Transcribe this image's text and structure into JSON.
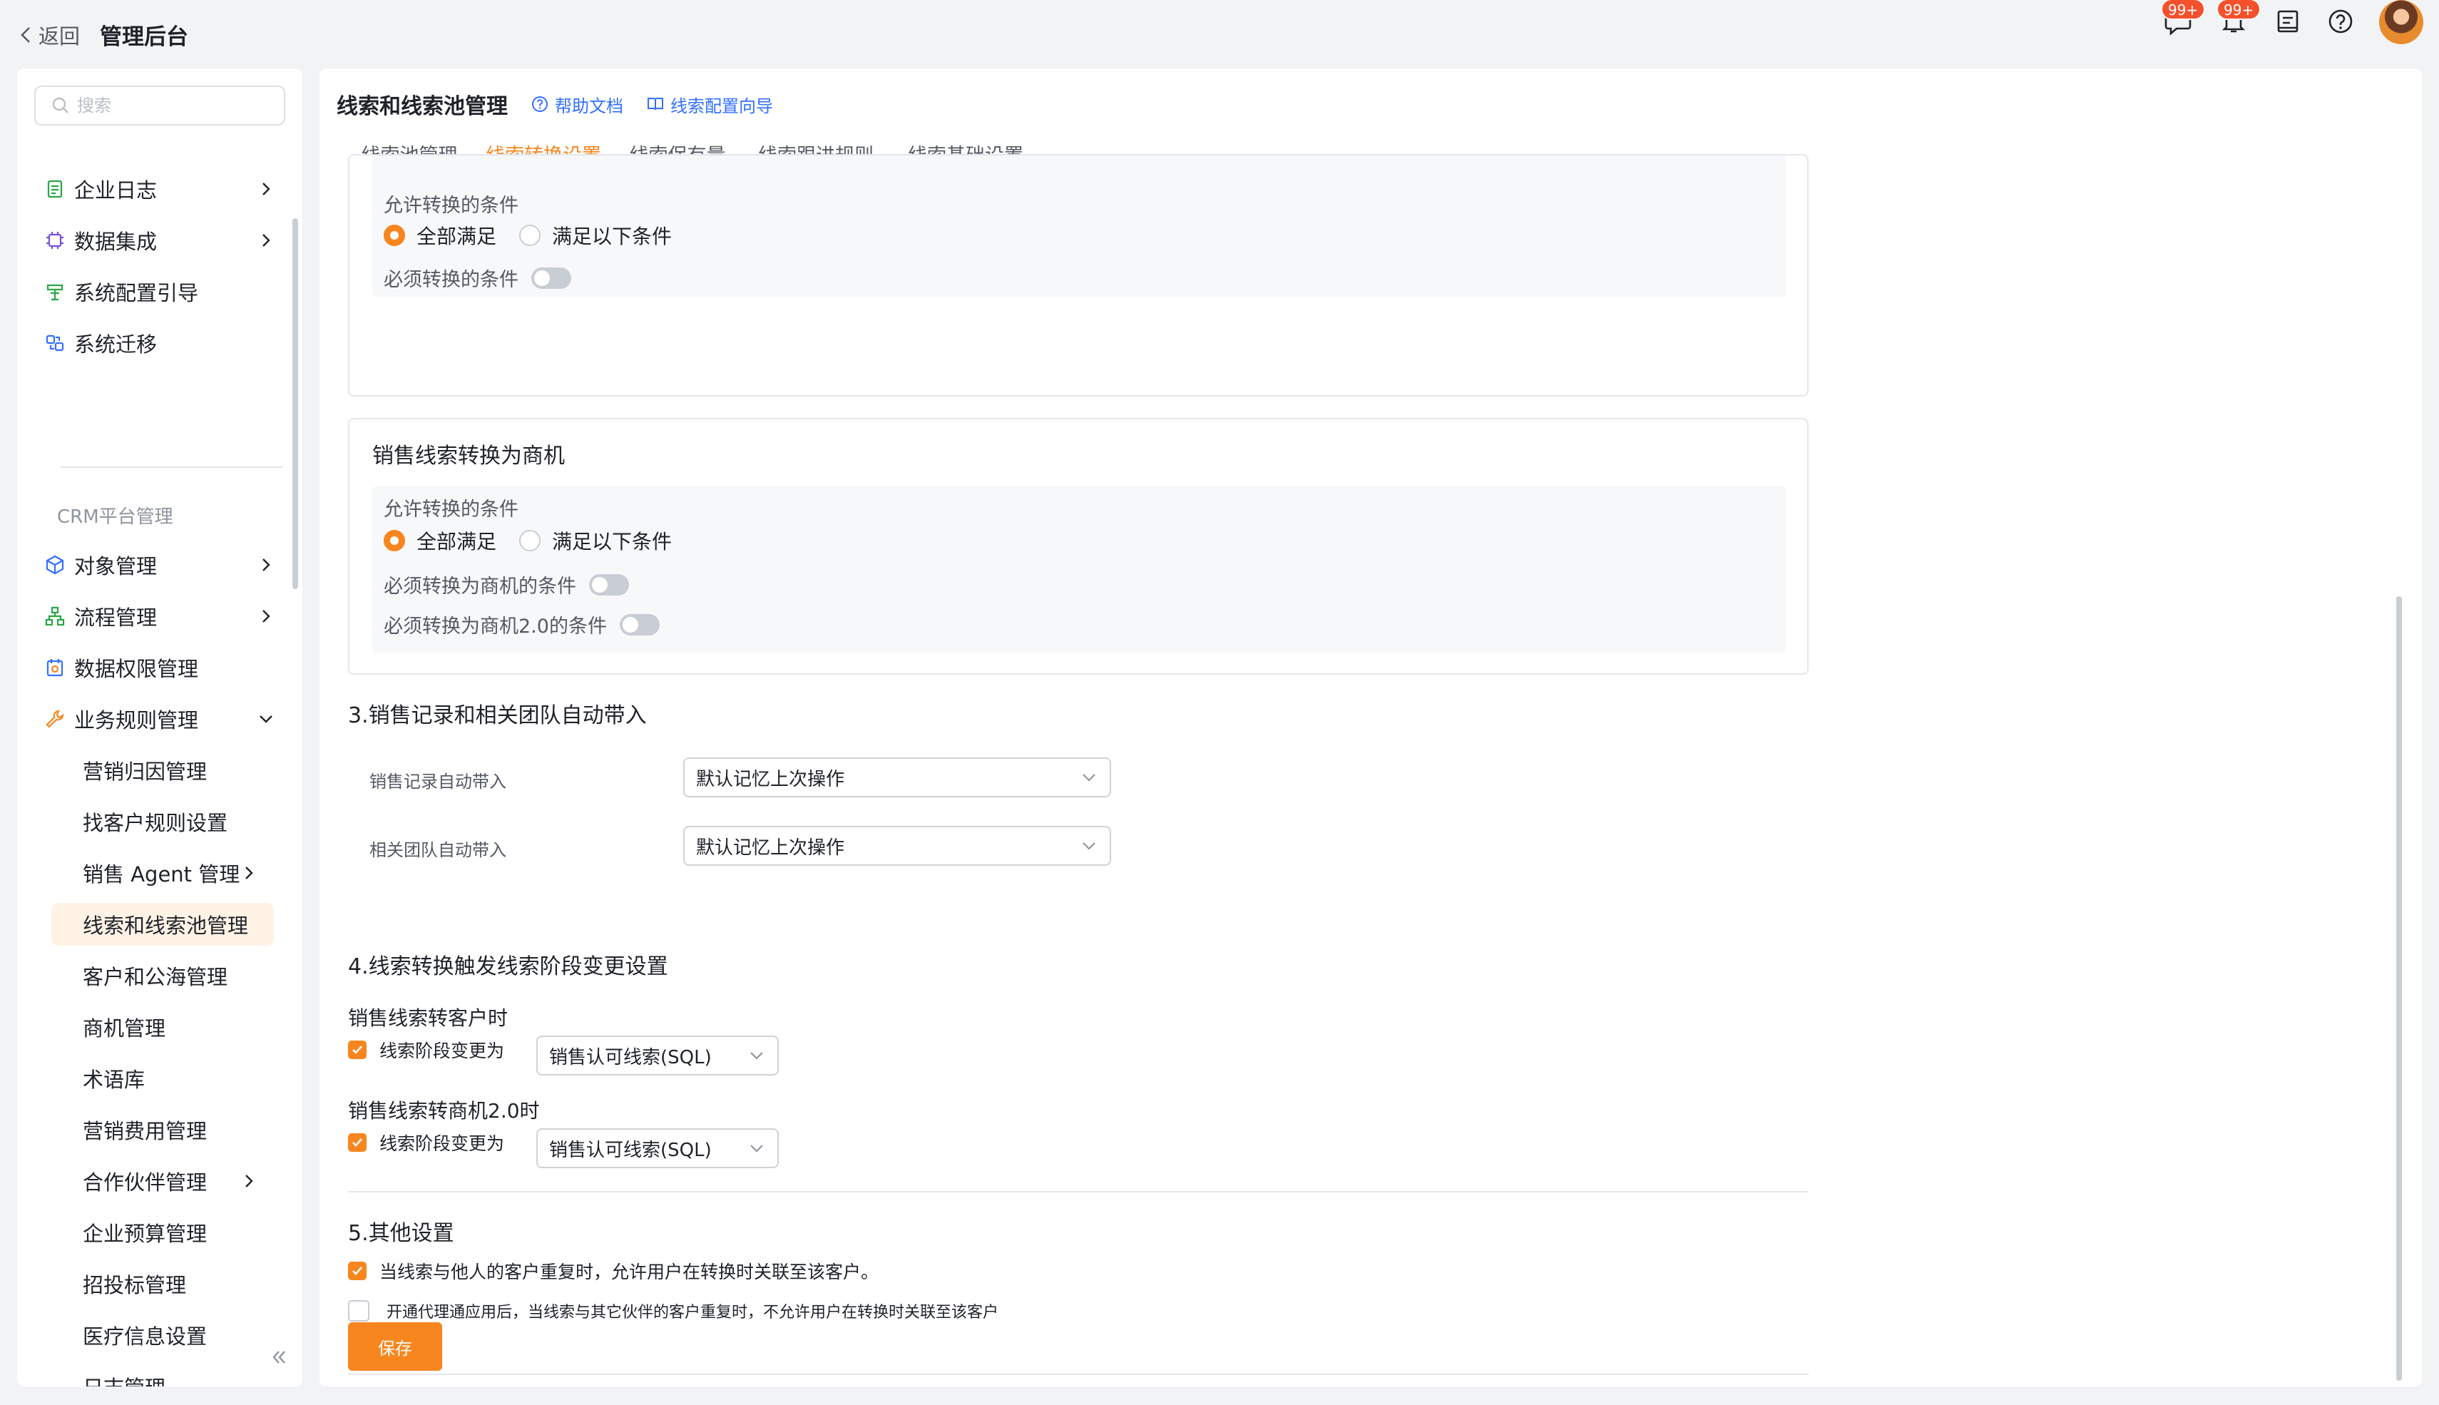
{
  "topbar": {
    "back_label": "返回",
    "app_title": "管理后台",
    "chat_badge": "99+",
    "bell_badge": "99+"
  },
  "sidebar": {
    "search_placeholder": "搜索",
    "top_items": [
      {
        "label": "企业日志",
        "icon": "log-icon"
      },
      {
        "label": "数据集成",
        "icon": "chip-icon"
      },
      {
        "label": "系统配置引导",
        "icon": "guide-icon"
      },
      {
        "label": "系统迁移",
        "icon": "migrate-icon"
      }
    ],
    "section_label": "CRM平台管理",
    "crm_items": [
      {
        "label": "对象管理",
        "icon": "cube-icon"
      },
      {
        "label": "流程管理",
        "icon": "flow-icon"
      },
      {
        "label": "数据权限管理",
        "icon": "permission-icon"
      },
      {
        "label": "业务规则管理",
        "icon": "wrench-icon"
      }
    ],
    "sub_items": [
      {
        "label": "营销归因管理"
      },
      {
        "label": "找客户规则设置"
      },
      {
        "label": "销售 Agent 管理"
      },
      {
        "label": "线索和线索池管理"
      },
      {
        "label": "客户和公海管理"
      },
      {
        "label": "商机管理"
      },
      {
        "label": "术语库"
      },
      {
        "label": "营销费用管理"
      },
      {
        "label": "合作伙伴管理"
      },
      {
        "label": "企业预算管理"
      },
      {
        "label": "招投标管理"
      },
      {
        "label": "医疗信息设置"
      },
      {
        "label": "日志管理"
      }
    ]
  },
  "main": {
    "title": "线索和线索池管理",
    "help_link": "帮助文档",
    "guide_link": "线索配置向导",
    "tabs": [
      {
        "label": "线索池管理"
      },
      {
        "label": "线索转换设置"
      },
      {
        "label": "线索保有量"
      },
      {
        "label": "线索跟进规则"
      },
      {
        "label": "线索基础设置"
      }
    ],
    "card1": {
      "allow_label": "允许转换的条件",
      "radio_all": "全部满足",
      "radio_some": "满足以下条件",
      "must_label": "必须转换的条件"
    },
    "card2": {
      "title": "销售线索转换为商机",
      "allow_label": "允许转换的条件",
      "radio_all": "全部满足",
      "radio_some": "满足以下条件",
      "must_opp": "必须转换为商机的条件",
      "must_opp2": "必须转换为商机2.0的条件"
    },
    "section3": {
      "title": "3.销售记录和相关团队自动带入",
      "record_label": "销售记录自动带入",
      "record_value": "默认记忆上次操作",
      "team_label": "相关团队自动带入",
      "team_value": "默认记忆上次操作"
    },
    "section4": {
      "title": "4.线索转换触发线索阶段变更设置",
      "to_customer": "销售线索转客户时",
      "to_opp2": "销售线索转商机2.0时",
      "stage_label": "线索阶段变更为",
      "stage_value_1": "销售认可线索(SQL)",
      "stage_value_2": "销售认可线索(SQL)"
    },
    "section5": {
      "title": "5.其他设置",
      "opt1": "当线索与他人的客户重复时，允许用户在转换时关联至该客户。",
      "opt2": "开通代理通应用后，当线索与其它伙伴的客户重复时，不允许用户在转换时关联至该客户"
    },
    "save_label": "保存"
  },
  "colors": {
    "accent": "#f7861e",
    "link": "#3370ff",
    "badge": "#f4512c"
  }
}
